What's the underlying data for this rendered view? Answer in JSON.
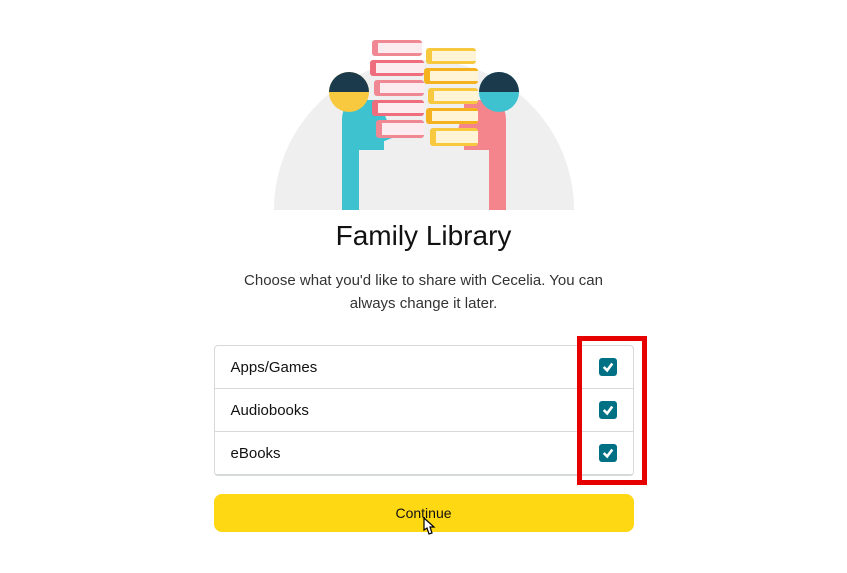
{
  "title": "Family Library",
  "subtitle": "Choose what you'd like to share with Cecelia. You can always change it later.",
  "options": [
    {
      "label": "Apps/Games",
      "checked": true
    },
    {
      "label": "Audiobooks",
      "checked": true
    },
    {
      "label": "eBooks",
      "checked": true
    }
  ],
  "continue_label": "Continue",
  "colors": {
    "accent": "#007185",
    "primary_button": "#ffd814",
    "highlight": "#e60000"
  }
}
